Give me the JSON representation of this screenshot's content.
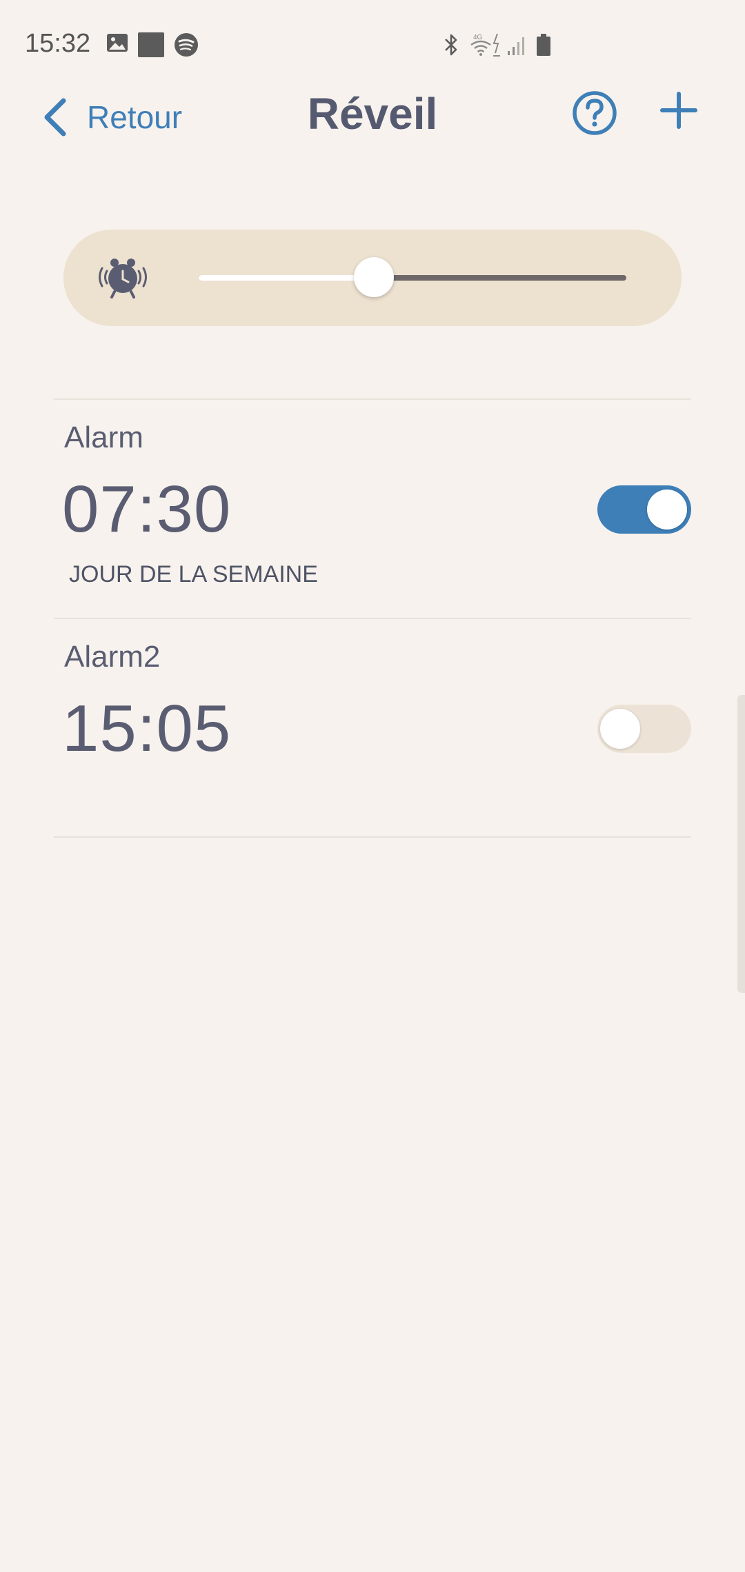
{
  "status_bar": {
    "time": "15:32",
    "left_icons": [
      "gallery-icon",
      "square-icon",
      "spotify-icon"
    ],
    "right_icons": [
      "bluetooth-icon",
      "4g-wifi-icon",
      "data-charging-icon",
      "signal-icon",
      "battery-icon"
    ]
  },
  "header": {
    "back_label": "Retour",
    "title": "Réveil",
    "help_icon": "question-circle-icon",
    "add_icon": "plus-icon"
  },
  "volume": {
    "icon": "alarm-clock-ringing-icon",
    "level_fraction": 0.41
  },
  "alarms": [
    {
      "name": "Alarm",
      "time": "07:30",
      "repeat": "JOUR DE LA SEMAINE",
      "enabled": true
    },
    {
      "name": "Alarm2",
      "time": "15:05",
      "repeat": "",
      "enabled": false
    }
  ],
  "colors": {
    "accent": "#3e7fb8",
    "background": "#f7f2ed",
    "card": "#ede1d0",
    "text": "#5a5d72",
    "toggle_on": "#3e7fb8",
    "toggle_off": "#ece3d6"
  }
}
